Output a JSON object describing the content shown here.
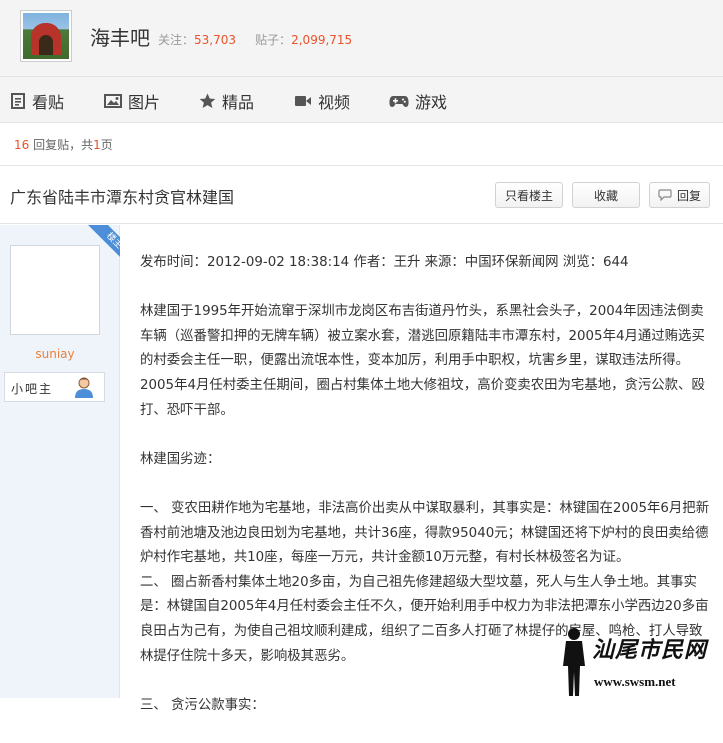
{
  "header": {
    "forum_name": "海丰吧",
    "follow_label": "关注：",
    "follow_count": "53,703",
    "post_label": "贴子：",
    "post_count": "2,099,715"
  },
  "nav": {
    "items": [
      {
        "label": "看贴",
        "icon": "document-icon"
      },
      {
        "label": "图片",
        "icon": "image-icon"
      },
      {
        "label": "精品",
        "icon": "star-icon"
      },
      {
        "label": "视频",
        "icon": "video-icon"
      },
      {
        "label": "游戏",
        "icon": "gamepad-icon"
      }
    ]
  },
  "page_info": {
    "reply_count": "16",
    "reply_label": "回复贴，共",
    "page_count": "1",
    "page_label": "页"
  },
  "thread": {
    "title": "广东省陆丰市潭东村贪官林建国",
    "btn_op_only": "只看楼主",
    "btn_collect": "收藏",
    "btn_reply": "回复"
  },
  "author": {
    "badge": "楼主",
    "username": "suniay",
    "role": "小吧主"
  },
  "post": {
    "paragraphs": [
      "发布时间：2012-09-02 18:38:14 作者：王升 来源：中国环保新闻网 浏览：644",
      "林建国于1995年开始流窜于深圳市龙岗区布吉街道丹竹头，系黑社会头子，2004年因违法倒卖车辆（巡番警扣押的无牌车辆）被立案水套，潜逃回原籍陆丰市潭东村，2005年4月通过贿选买的村委会主任一职，便露出流氓本性，变本加厉，利用手中职权，坑害乡里，谋取违法所得。2005年4月任村委主任期间，圈占村集体土地大修祖坟，高价变卖农田为宅基地，贪污公款、殴打、恐吓干部。",
      "林建国劣迹：",
      "一、 变农田耕作地为宅基地，非法高价出卖从中谋取暴利，其事实是：林键国在2005年6月把新香村前池塘及池边良田划为宅基地，共计36座，得款95040元；林键国还将下炉村的良田卖给德炉村作宅基地，共10座，每座一万元，共计金额10万元整，有村长林极签名为证。\n二、 圈占新香村集体土地20多亩，为自己祖先修建超级大型坟墓，死人与生人争土地。其事实是：林键国自2005年4月任村委会主任不久，便开始利用手中权力为非法把潭东小学西边20多亩良田占为己有，为使自己祖坟顺利建成，组织了二百多人打砸了林提仔的房屋、鸣枪、打人导致林提仔住院十多天，影响极其恶劣。",
      "三、 贪污公款事实："
    ]
  },
  "watermark": {
    "text": "汕尾市民网",
    "url": "www.swsm.net"
  }
}
